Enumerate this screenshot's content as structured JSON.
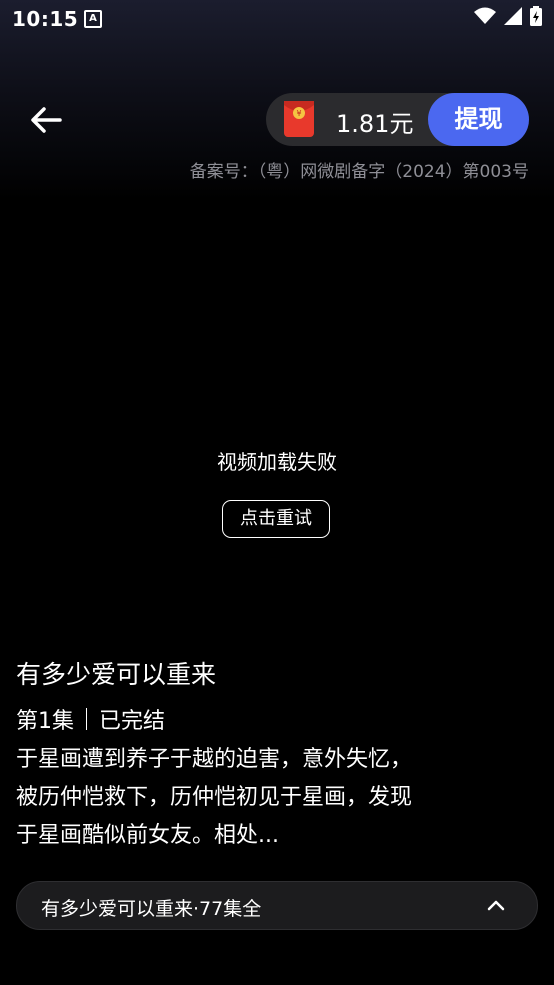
{
  "status_bar": {
    "time": "10:15",
    "app_icon_letter": "A"
  },
  "header": {
    "balance": "1.81元",
    "withdraw_label": "提现",
    "license": "备案号：（粤）网微剧备字（2024）第003号"
  },
  "player": {
    "error_message": "视频加载失败",
    "retry_label": "点击重试"
  },
  "drama": {
    "title": "有多少爱可以重来",
    "episode": "第1集",
    "status": "已完结",
    "synopsis": "于星画遭到养子于越的迫害，意外失忆，被历仲恺救下，历仲恺初见于星画，发现于星画酷似前女友。相处..."
  },
  "collection": {
    "label": "有多少爱可以重来·77集全"
  },
  "colors": {
    "accent": "#4b68f0",
    "pill_bg": "#2b2b2e",
    "muted_text": "#8f8f96"
  },
  "icons": [
    "wifi-icon",
    "cell-signal-icon",
    "battery-icon",
    "back-arrow-icon",
    "red-packet-icon",
    "chevron-up-icon"
  ]
}
